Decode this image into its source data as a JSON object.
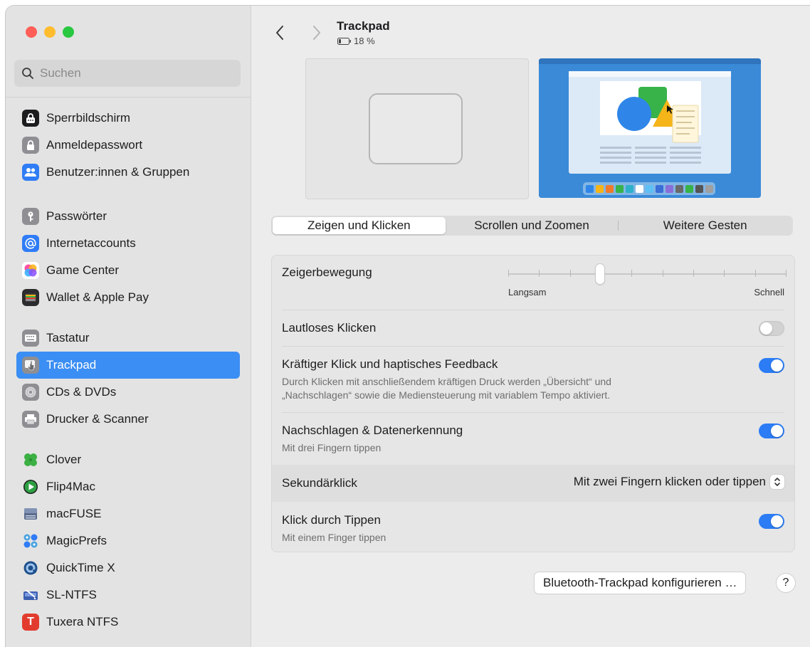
{
  "window": {
    "title": "Trackpad",
    "battery": "18 %"
  },
  "search": {
    "placeholder": "Suchen"
  },
  "sidebar": {
    "groups": [
      [
        {
          "label": "Sperrbildschirm",
          "icon": "lock-screen-icon",
          "color": "#1c1c1e"
        },
        {
          "label": "Anmeldepasswort",
          "icon": "padlock-icon",
          "color": "#8e8e93"
        },
        {
          "label": "Benutzer:innen & Gruppen",
          "icon": "users-icon",
          "color": "#2f7cf6"
        }
      ],
      [
        {
          "label": "Passwörter",
          "icon": "key-icon",
          "color": "#8e8e93"
        },
        {
          "label": "Internetaccounts",
          "icon": "at-icon",
          "color": "#2f7cf6"
        },
        {
          "label": "Game Center",
          "icon": "game-center-icon",
          "color": "#ffffff"
        },
        {
          "label": "Wallet & Apple Pay",
          "icon": "wallet-icon",
          "color": "#2c2c2e"
        }
      ],
      [
        {
          "label": "Tastatur",
          "icon": "keyboard-icon",
          "color": "#8e8e93"
        },
        {
          "label": "Trackpad",
          "icon": "trackpad-icon",
          "color": "#8e8e93",
          "active": true
        },
        {
          "label": "CDs & DVDs",
          "icon": "disc-icon",
          "color": "#8e8e93"
        },
        {
          "label": "Drucker & Scanner",
          "icon": "printer-icon",
          "color": "#8e8e93"
        }
      ],
      [
        {
          "label": "Clover",
          "icon": "clover-icon",
          "color": "#3cb043"
        },
        {
          "label": "Flip4Mac",
          "icon": "play-icon",
          "color": "#2ea043"
        },
        {
          "label": "macFUSE",
          "icon": "fuse-icon",
          "color": "#5a6b8c"
        },
        {
          "label": "MagicPrefs",
          "icon": "magicprefs-icon",
          "color": "#4aa3e0"
        },
        {
          "label": "QuickTime X",
          "icon": "quicktime-icon",
          "color": "#1f4f8a"
        },
        {
          "label": "SL-NTFS",
          "icon": "drive-icon",
          "color": "#3b5fb0"
        },
        {
          "label": "Tuxera NTFS",
          "icon": "tuxera-icon",
          "color": "#e23b2e"
        }
      ]
    ]
  },
  "tabs": [
    {
      "label": "Zeigen und Klicken",
      "active": true
    },
    {
      "label": "Scrollen und Zoomen",
      "active": false
    },
    {
      "label": "Weitere Gesten",
      "active": false
    }
  ],
  "settings": {
    "pointer_speed": {
      "label": "Zeigerbewegung",
      "min_label": "Langsam",
      "max_label": "Schnell",
      "ticks": 10,
      "value_fraction": 0.33
    },
    "silent_click": {
      "label": "Lautloses Klicken",
      "on": false
    },
    "force_click": {
      "label": "Kräftiger Klick und haptisches Feedback",
      "desc_line1": "Durch Klicken mit anschließendem kräftigen Druck werden „Übersicht“ und",
      "desc_line2": "„Nachschlagen“ sowie die Mediensteuerung mit variablem Tempo aktiviert.",
      "on": true
    },
    "lookup": {
      "label": "Nachschlagen & Datenerkennung",
      "desc": "Mit drei Fingern tippen",
      "on": true
    },
    "secondary_click": {
      "label": "Sekundärklick",
      "value": "Mit zwei Fingern klicken oder tippen"
    },
    "tap_to_click": {
      "label": "Klick durch Tippen",
      "desc": "Mit einem Finger tippen",
      "on": true
    }
  },
  "footer": {
    "bluetooth_button": "Bluetooth-Trackpad konfigurieren …",
    "help_button": "?"
  },
  "colors": {
    "accent": "#2b7cf5",
    "sidebar_active": "#3b8ef3"
  }
}
